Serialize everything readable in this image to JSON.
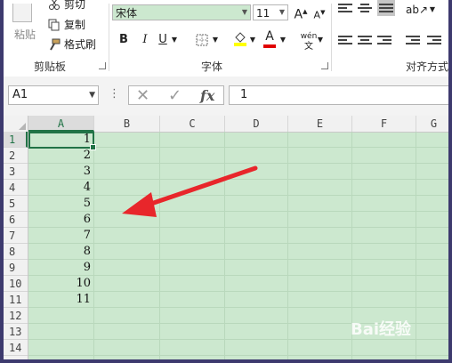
{
  "ribbon": {
    "clipboard": {
      "paste_label": "粘贴",
      "cut_label": "剪切",
      "copy_label": "复制",
      "format_painter_label": "格式刷",
      "group_label": "剪贴板"
    },
    "font": {
      "font_name": "宋体",
      "font_size": "11",
      "bold": "B",
      "italic": "I",
      "underline": "U",
      "font_color_glyph": "A",
      "phonetic_glyph": "wén",
      "grow_glyph": "A",
      "shrink_glyph": "A",
      "group_label": "字体"
    },
    "alignment": {
      "group_label": "对齐方式"
    }
  },
  "formula_bar": {
    "name_box": "A1",
    "cancel_glyph": "✕",
    "enter_glyph": "✓",
    "fx_glyph": "fx",
    "value": "1"
  },
  "sheet": {
    "columns": [
      "A",
      "B",
      "C",
      "D",
      "E",
      "F",
      "G"
    ],
    "rows": [
      "1",
      "2",
      "3",
      "4",
      "5",
      "6",
      "7",
      "8",
      "9",
      "10",
      "11",
      "12",
      "13",
      "14"
    ],
    "column_a_values": [
      "1",
      "2",
      "3",
      "4",
      "5",
      "6",
      "7",
      "8",
      "9",
      "10",
      "11"
    ],
    "selected_cell": "A1"
  },
  "watermark": "Bai经验",
  "colors": {
    "grid_fill": "#cce8cf",
    "selection": "#217346",
    "annotation_arrow": "#e8262b",
    "font_color_bar": "#e00000",
    "highlight_bar": "#ffff00"
  }
}
